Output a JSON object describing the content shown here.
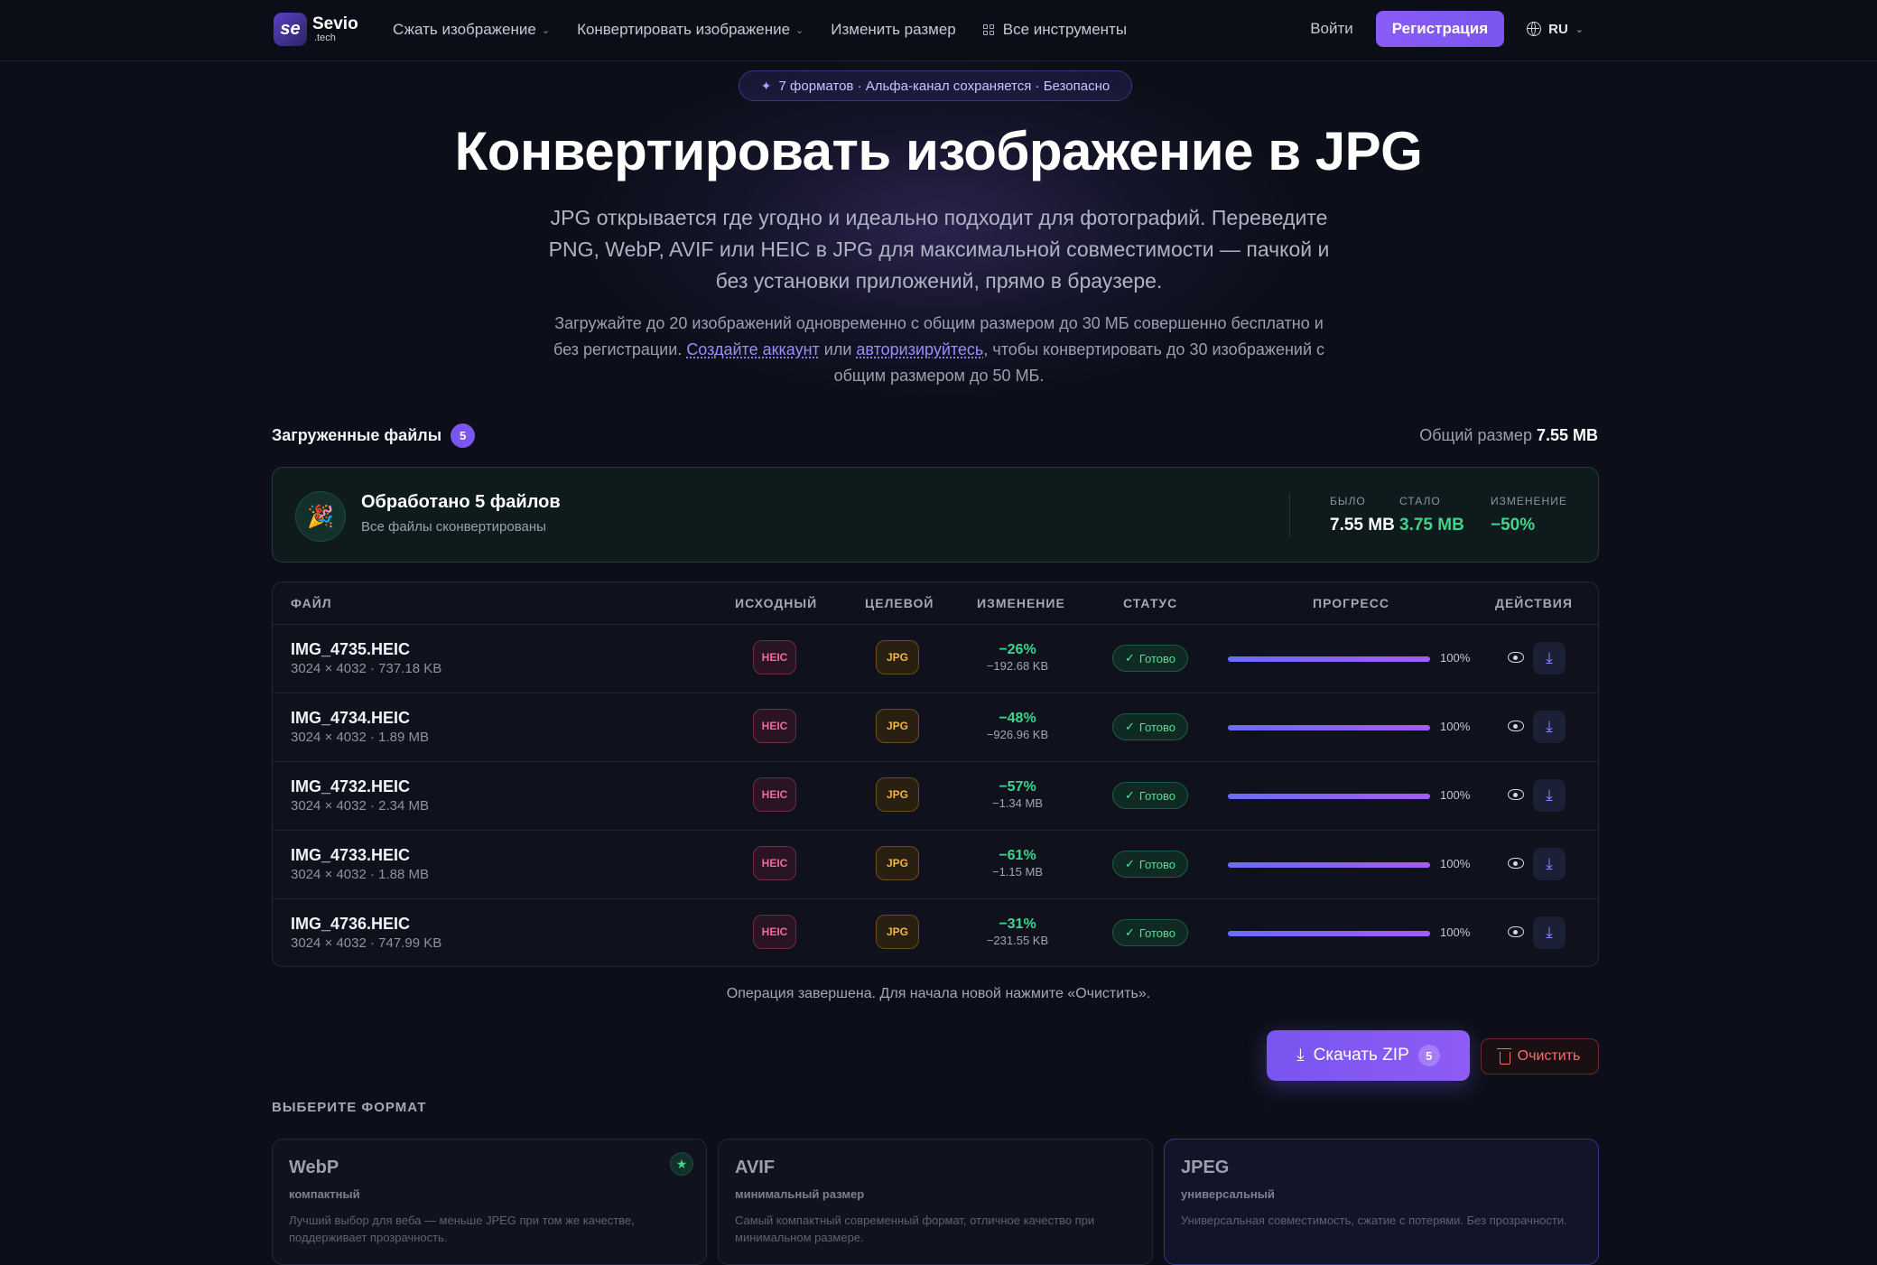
{
  "brand": {
    "name": "Sevio",
    "domain": ".tech",
    "mark": "se"
  },
  "nav": {
    "items": [
      {
        "label": "Сжать изображение",
        "dropdown": true
      },
      {
        "label": "Конвертировать изображение",
        "dropdown": true
      },
      {
        "label": "Изменить размер",
        "dropdown": false
      },
      {
        "label": "Все инструменты",
        "dropdown": false
      }
    ],
    "login": "Войти",
    "signup": "Регистрация",
    "lang": "RU"
  },
  "hero": {
    "pill": "7 форматов · Альфа-канал сохраняется · Безопасно",
    "title": "Конвертировать изображение в JPG",
    "lead": "JPG открывается где угодно и идеально подходит для фотографий. Переведите PNG, WebP, AVIF или HEIC в JPG для максимальной совместимости — пачкой и без установки приложений, прямо в браузере.",
    "sub_before": "Загружайте до 20 изображений одновременно с общим размером до 30 МБ совершенно бесплатно и без регистрации.",
    "sub_link1": "Создайте аккаунт",
    "sub_mid": "или",
    "sub_link2": "авторизируйтесь",
    "sub_after": ", чтобы конвертировать до 30 изображений с общим размером до 50 МБ."
  },
  "files": {
    "title": "Загруженные файлы",
    "count": "5",
    "total_label": "Общий размер",
    "total_value": "7.55 MB"
  },
  "summary": {
    "title": "Обработано 5 файлов",
    "subtitle": "Все файлы сконвертированы",
    "before_label": "БЫЛО",
    "before_value": "7.55 MB",
    "after_label": "СТАЛО",
    "after_value": "3.75 MB",
    "change_label": "ИЗМЕНЕНИЕ",
    "change_value": "−50%",
    "colors": {
      "after": "#3ed68a",
      "change": "#3ed68a"
    }
  },
  "table": {
    "headers": {
      "file": "ФАЙЛ",
      "source": "ИСХОДНЫЙ",
      "target": "ЦЕЛЕВОЙ",
      "change": "ИЗМЕНЕНИЕ",
      "status": "СТАТУС",
      "progress": "ПРОГРЕСС",
      "actions": "ДЕЙСТВИЯ"
    },
    "rows": [
      {
        "name": "IMG_4735.HEIC",
        "meta": "3024 × 4032 · 737.18 KB",
        "src": "HEIC",
        "dst": "JPG",
        "pct": "−26%",
        "saved": "−192.68 KB",
        "status": "Готово",
        "progress": 100,
        "progress_label": "100%"
      },
      {
        "name": "IMG_4734.HEIC",
        "meta": "3024 × 4032 · 1.89 MB",
        "src": "HEIC",
        "dst": "JPG",
        "pct": "−48%",
        "saved": "−926.96 KB",
        "status": "Готово",
        "progress": 100,
        "progress_label": "100%"
      },
      {
        "name": "IMG_4732.HEIC",
        "meta": "3024 × 4032 · 2.34 MB",
        "src": "HEIC",
        "dst": "JPG",
        "pct": "−57%",
        "saved": "−1.34 MB",
        "status": "Готово",
        "progress": 100,
        "progress_label": "100%"
      },
      {
        "name": "IMG_4733.HEIC",
        "meta": "3024 × 4032 · 1.88 MB",
        "src": "HEIC",
        "dst": "JPG",
        "pct": "−61%",
        "saved": "−1.15 MB",
        "status": "Готово",
        "progress": 100,
        "progress_label": "100%"
      },
      {
        "name": "IMG_4736.HEIC",
        "meta": "3024 × 4032 · 747.99 KB",
        "src": "HEIC",
        "dst": "JPG",
        "pct": "−31%",
        "saved": "−231.55 KB",
        "status": "Готово",
        "progress": 100,
        "progress_label": "100%"
      }
    ]
  },
  "done_note": "Операция завершена. Для начала новой нажмите «Очистить».",
  "actions": {
    "zip_label": "Скачать ZIP",
    "zip_count": "5",
    "clear_label": "Очистить"
  },
  "formats": {
    "title": "ВЫБЕРИТЕ ФОРМАТ",
    "cards": [
      {
        "name": "WebP",
        "tag": "компактный",
        "desc": "Лучший выбор для веба — меньше JPEG при том же качестве, поддерживает прозрачность.",
        "recommended": true
      },
      {
        "name": "AVIF",
        "tag": "минимальный размер",
        "desc": "Самый компактный современный формат, отличное качество при минимальном размере.",
        "recommended": false
      },
      {
        "name": "JPEG",
        "tag": "универсальный",
        "desc": "Универсальная совместимость, сжатие с потерями. Без прозрачности.",
        "recommended": false
      }
    ]
  }
}
